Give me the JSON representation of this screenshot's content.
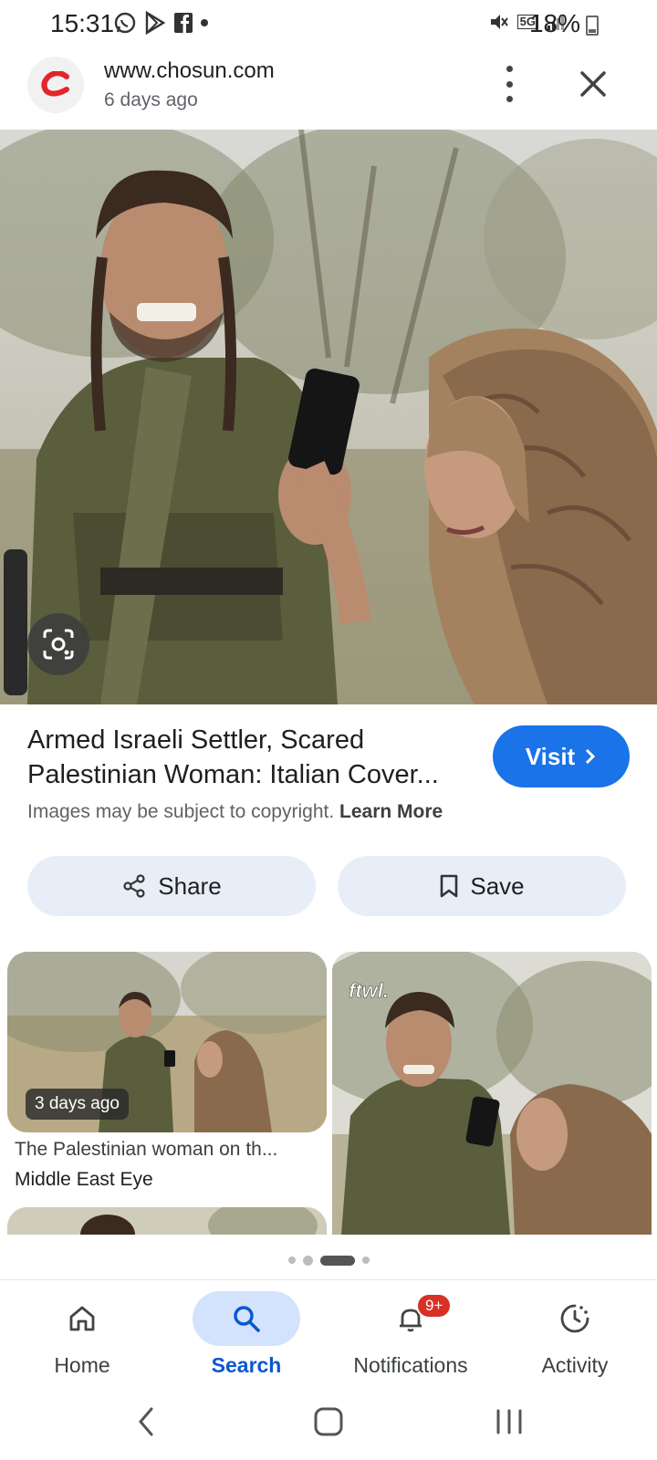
{
  "status_bar": {
    "time": "15:31",
    "network": "5G",
    "battery": "18%",
    "left_icons": [
      "whatsapp-icon",
      "play-store-icon",
      "facebook-icon",
      "dot-icon"
    ],
    "right_icons": [
      "mute-icon",
      "5g-icon",
      "signal-icon",
      "battery-icon"
    ]
  },
  "header": {
    "url": "www.chosun.com",
    "time": "6 days ago",
    "logo_color": "#e3242b"
  },
  "result": {
    "title": "Armed Israeli Settler, Scared Palestinian Woman: Italian Cover...",
    "visit_label": "Visit",
    "copyright_text": "Images may be subject to copyright.",
    "learn_more": "Learn More",
    "share_label": "Share",
    "save_label": "Save"
  },
  "related": [
    {
      "badge": "3 days ago",
      "title": "The Palestinian woman on th...",
      "source": "Middle East Eye"
    },
    {
      "watermark": "ftwl."
    }
  ],
  "bottom_nav": [
    {
      "label": "Home",
      "icon": "home-icon"
    },
    {
      "label": "Search",
      "icon": "search-icon",
      "active": true
    },
    {
      "label": "Notifications",
      "icon": "bell-icon",
      "badge": "9+"
    },
    {
      "label": "Activity",
      "icon": "activity-icon"
    }
  ],
  "colors": {
    "accent": "#1a73e8",
    "active_nav": "#0b57d0",
    "active_pill": "#d3e3fd",
    "badge_red": "#d93025",
    "button_bg": "#e8eef8"
  }
}
